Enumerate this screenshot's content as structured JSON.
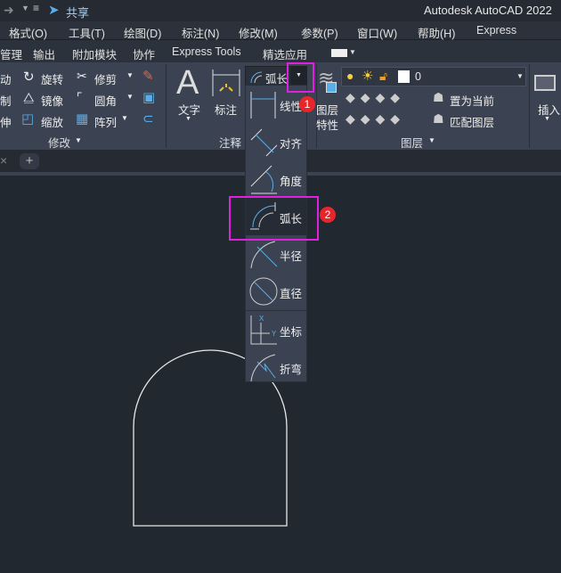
{
  "titlebar": {
    "share": "共享",
    "app_title": "Autodesk AutoCAD 2022"
  },
  "menu": [
    "格式(O)",
    "工具(T)",
    "绘图(D)",
    "标注(N)",
    "修改(M)",
    "参数(P)",
    "窗口(W)",
    "帮助(H)",
    "Express"
  ],
  "ribbon_tabs": [
    "管理",
    "输出",
    "附加模块",
    "协作",
    "Express Tools",
    "精选应用"
  ],
  "modify": {
    "items": [
      "动",
      "旋转",
      "修剪",
      "制",
      "镜像",
      "圆角",
      "伸",
      "缩放",
      "阵列"
    ],
    "panel": "修改"
  },
  "annotation": {
    "text": "文字",
    "dim": "标注",
    "current": "弧长",
    "panel": "注释"
  },
  "layers": {
    "layer_props": [
      "图层",
      "特性"
    ],
    "current_layer": "0",
    "set_current": "置为当前",
    "match": "匹配图层",
    "panel": "图层"
  },
  "insert": {
    "label": "插入"
  },
  "dropdown": [
    "线性",
    "对齐",
    "角度",
    "弧长",
    "半径",
    "直径",
    "坐标",
    "折弯"
  ],
  "badges": [
    "1",
    "2"
  ],
  "colors": {
    "highlight": "#e020e0",
    "badge": "#e8262a",
    "accent": "#5aaee8"
  }
}
